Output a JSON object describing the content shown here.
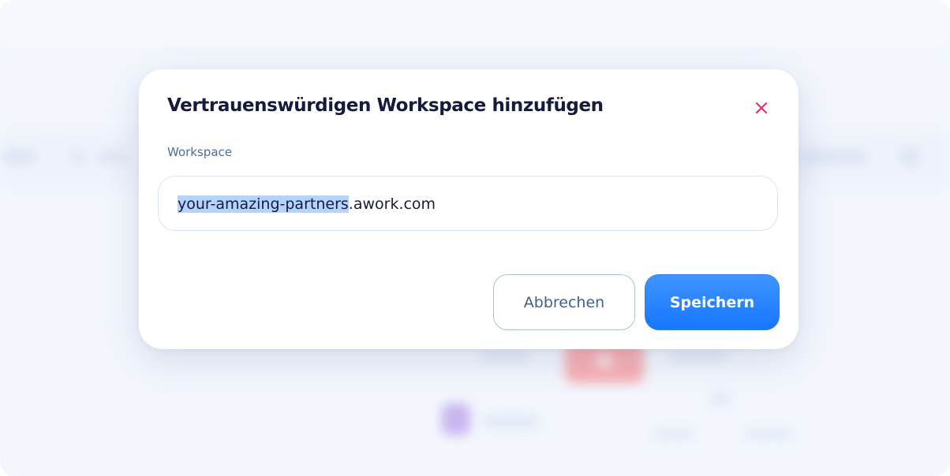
{
  "dialog": {
    "title": "Vertrauenswürdigen Workspace hinzufügen",
    "close_icon": "close-icon",
    "field_label": "Workspace",
    "input": {
      "selected_text": "your-amazing-partners",
      "rest_text": ".awork.com"
    },
    "cancel_label": "Abbrechen",
    "save_label": "Speichern"
  },
  "colors": {
    "accent": "#1677ff",
    "close_icon": "#e5306e",
    "title": "#151b3d",
    "label": "#4a6ea3",
    "selection": "#b5d3ff"
  }
}
